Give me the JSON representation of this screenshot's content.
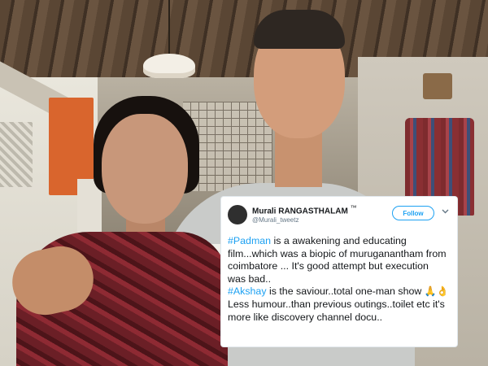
{
  "tweet": {
    "display_name": "Murali RANGASTHALAM",
    "tm": "™",
    "handle": "@Murali_tweetz",
    "follow_label": "Follow",
    "caret_icon": "chevron-down-icon",
    "hashtag_1": "#Padman",
    "text_1": " is a awakening and educating film...which was a biopic of muruganantham from coimbatore ... It's good attempt but execution was bad..",
    "hashtag_2": "#Akshay",
    "text_2": " is the saviour..total one-man show ",
    "emoji": "🙏👌",
    "text_3": "Less humour..than previous outings..toilet etc it's more like discovery channel docu..",
    "colors": {
      "link": "#1da1f2",
      "text": "#14171a",
      "muted": "#657786"
    }
  }
}
